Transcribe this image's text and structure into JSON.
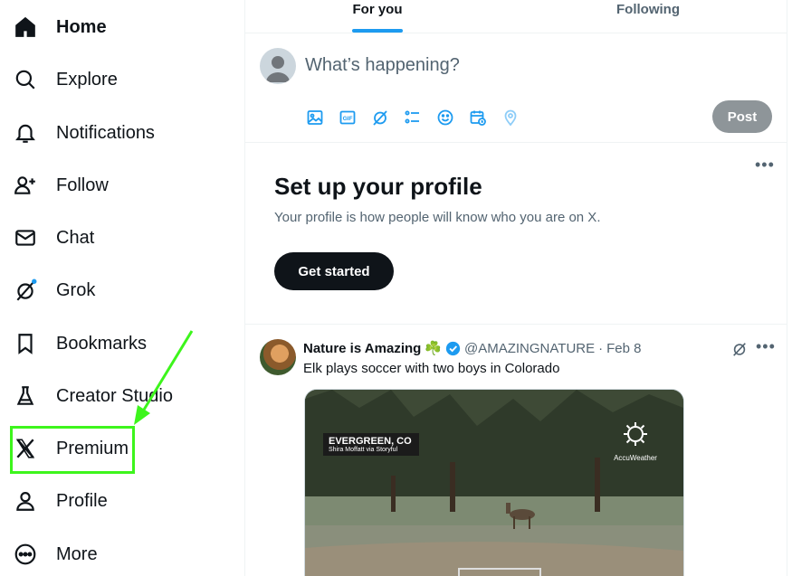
{
  "nav": [
    {
      "key": "home",
      "label": "Home",
      "icon": "home-icon",
      "active": true
    },
    {
      "key": "explore",
      "label": "Explore",
      "icon": "search-icon"
    },
    {
      "key": "notifications",
      "label": "Notifications",
      "icon": "bell-icon"
    },
    {
      "key": "follow",
      "label": "Follow",
      "icon": "follow-icon"
    },
    {
      "key": "chat",
      "label": "Chat",
      "icon": "mail-icon"
    },
    {
      "key": "grok",
      "label": "Grok",
      "icon": "grok-icon"
    },
    {
      "key": "bookmarks",
      "label": "Bookmarks",
      "icon": "bookmark-icon"
    },
    {
      "key": "creator_studio",
      "label": "Creator Studio",
      "icon": "flask-icon"
    },
    {
      "key": "premium",
      "label": "Premium",
      "icon": "x-logo-icon"
    },
    {
      "key": "profile",
      "label": "Profile",
      "icon": "person-icon"
    },
    {
      "key": "more",
      "label": "More",
      "icon": "more-circle-icon"
    }
  ],
  "annotation": {
    "highlight_color": "#3df51c",
    "target": "Premium"
  },
  "tabs": {
    "for_you": "For you",
    "following": "Following"
  },
  "composer": {
    "placeholder": "What’s happening?",
    "tools": [
      "image-icon",
      "gif-icon",
      "grok-icon",
      "poll-icon",
      "emoji-icon",
      "schedule-icon",
      "location-icon"
    ],
    "post_label": "Post"
  },
  "setup": {
    "title": "Set up your profile",
    "description": "Your profile is how people will know who you are on X.",
    "button": "Get started"
  },
  "tweet": {
    "name": "Nature is Amazing",
    "emoji": "☘️",
    "handle": "@AMAZINGNATURE",
    "separator": "·",
    "date": "Feb 8",
    "text": "Elk plays soccer with two boys in Colorado",
    "media": {
      "place": "EVERGREEN, CO",
      "credit": "Shira Moffatt via Storyful",
      "watermark": "AccuWeather"
    }
  },
  "colors": {
    "accent": "#1d9bf0",
    "text": "#0f1419",
    "muted": "#536471",
    "post_disabled": "#8e9599"
  }
}
